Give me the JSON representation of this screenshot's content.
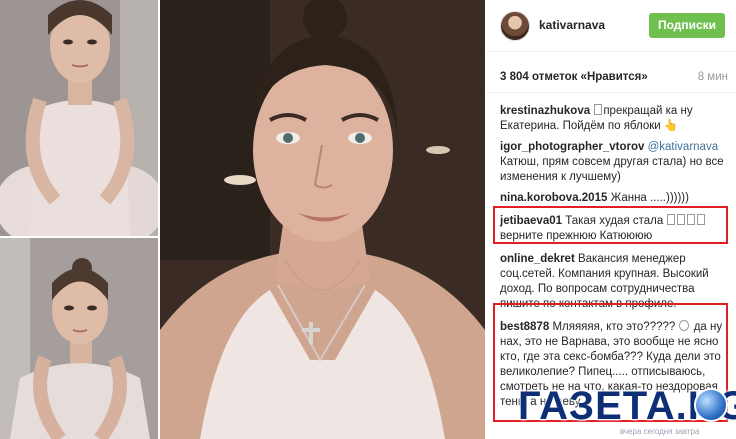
{
  "post": {
    "username": "kativarnava",
    "follow_label": "Подписки",
    "likes": "3 804 отметок «Нравится»",
    "time": "8 мин"
  },
  "comments": [
    {
      "user": "krestinazhukova",
      "text": "прекращай ка ну Екатерина. Пойдём по яблоки 👆"
    },
    {
      "user": "igor_photographer_vtorov",
      "mention": "@kativarnava",
      "text": "Катюш, прям совсем другая стала) но все изменения к лучшему)"
    },
    {
      "user": "nina.korobova.2015",
      "text": "Жанна .....))))))"
    },
    {
      "user": "jetibaeva01",
      "text": "Такая худая стала",
      "text2": "верните прежнюю Катюююю"
    },
    {
      "user": "online_dekret",
      "text": "Вакансия менеджер соц.сетей. Компания крупная. Высокий доход. По вопросам сотрудничества пишите по контактам в профиле."
    },
    {
      "user": "best8878",
      "text": "Мляяяяя, кто это?????",
      "text2": "да ну нах, это не Варнава, это вообще не ясно кто, где эта секс-бомба??? Куда дели это великолепие? Пипец..... отписываюсь, смотреть не на что, какая-то нездоровая тень, а не деву..."
    }
  ],
  "watermark": {
    "name": "ГАЗЕТА.KG",
    "tagline": "вчера сегодня завтра"
  }
}
